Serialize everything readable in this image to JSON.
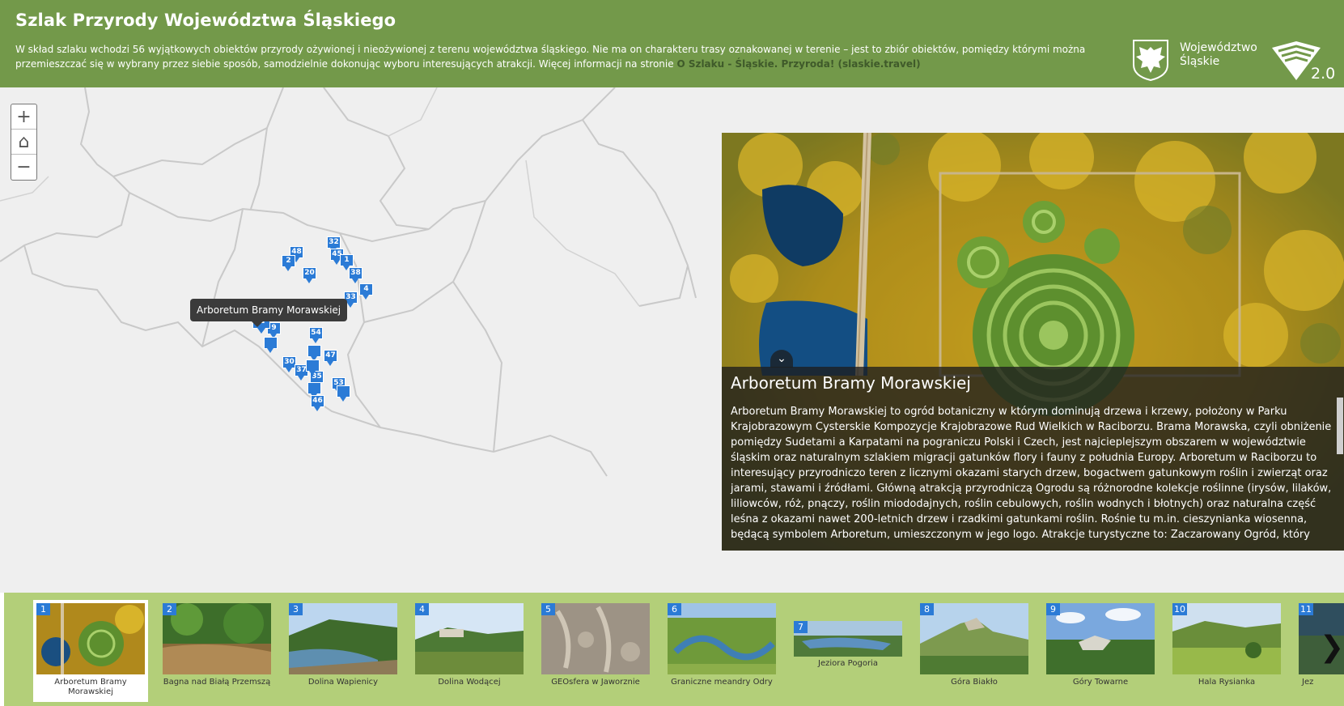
{
  "header": {
    "title": "Szlak Przyrody Województwa Śląskiego",
    "description": "W skład szlaku wchodzi 56 wyjątkowych obiektów przyrody ożywionej i nieożywionej z terenu województwa śląskiego. Nie ma on charakteru trasy oznakowanej w terenie – jest to zbiór obiektów, pomiędzy którymi można przemieszczać się w wybrany przez siebie sposób, samodzielnie dokonując wyboru interesujących atrakcji. Więcej informacji na stronie ",
    "link_text": "O Szlaku - Śląskie. Przyroda! (slaskie.travel)",
    "logo_region_line1": "Województwo",
    "logo_region_line2": "Śląskie",
    "logo_version": "2.0"
  },
  "map": {
    "zoom_in": "+",
    "home": "⌂",
    "zoom_out": "−",
    "tooltip": "Arboretum Bramy Morawskiej",
    "markers": [
      "48",
      "2",
      "32",
      "45",
      "1",
      "20",
      "38",
      "4",
      "33",
      "5",
      "54",
      "9",
      "30",
      "37",
      "35",
      "47",
      "53",
      "46",
      "1"
    ]
  },
  "panel": {
    "title": "Arboretum Bramy Morawskiej",
    "text": "Arboretum Bramy Morawskiej to ogród botaniczny w którym dominują drzewa i krzewy, położony w Parku Krajobrazowym Cysterskie Kompozycje Krajobrazowe Rud Wielkich w Raciborzu. Brama Morawska, czyli obniżenie pomiędzy Sudetami a Karpatami na pograniczu Polski i Czech, jest najcieplejszym obszarem w województwie śląskim oraz naturalnym szlakiem migracji gatunków flory i fauny z południa Europy. Arboretum w Raciborzu to interesujący przyrodniczo teren z licznymi okazami starych drzew, bogactwem gatunkowym roślin i zwierząt oraz jarami, stawami i źródłami. Główną atrakcją przyrodniczą Ogrodu są różnorodne kolekcje roślinne (irysów, lilaków, liliowców, róż, pnączy, roślin miododajnych, roślin cebulowych, roślin wodnych i błotnych) oraz naturalna część leśna z okazami nawet 200-letnich drzew i rzadkimi gatunkami roślin. Rośnie tu m.in. cieszynianka wiosenna, będącą symbolem Arboretum, umieszczonym w jego logo. Atrakcje turystyczne to: Zaczarowany Ogród, który"
  },
  "carousel": {
    "items": [
      {
        "num": "1",
        "label": "Arboretum Bramy Morawskiej"
      },
      {
        "num": "2",
        "label": "Bagna nad Białą Przemszą"
      },
      {
        "num": "3",
        "label": "Dolina Wapienicy"
      },
      {
        "num": "4",
        "label": "Dolina Wodącej"
      },
      {
        "num": "5",
        "label": "GEOsfera w Jaworznie"
      },
      {
        "num": "6",
        "label": "Graniczne meandry Odry"
      },
      {
        "num": "7",
        "label": "Jeziora Pogoria"
      },
      {
        "num": "8",
        "label": "Góra Biakło"
      },
      {
        "num": "9",
        "label": "Góry Towarne"
      },
      {
        "num": "10",
        "label": "Hala Rysianka"
      },
      {
        "num": "11",
        "label": "Jez"
      }
    ],
    "next": "❯"
  }
}
